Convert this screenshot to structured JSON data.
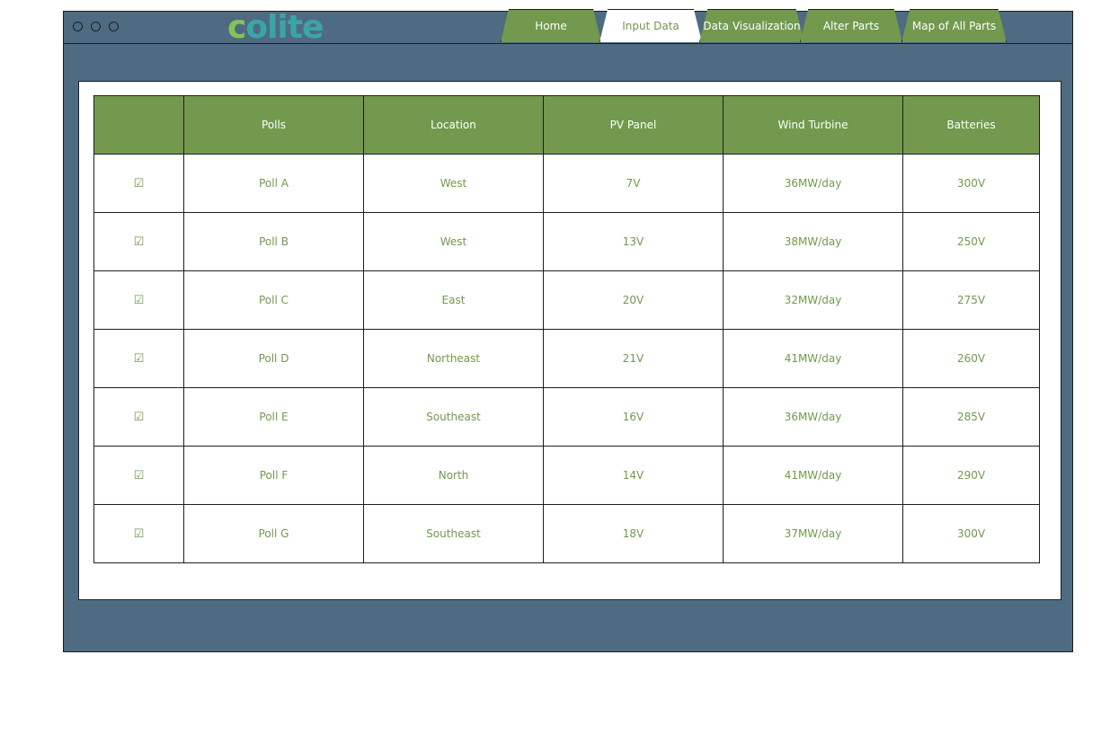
{
  "app": {
    "logo_first": "c",
    "logo_rest": "olite"
  },
  "tabs": [
    {
      "label": "Home",
      "active": false
    },
    {
      "label": "Input Data",
      "active": true
    },
    {
      "label": "Data Visualization",
      "active": false
    },
    {
      "label": "Alter Parts",
      "active": false
    },
    {
      "label": "Map of All Parts",
      "active": false
    }
  ],
  "table": {
    "headers": [
      "",
      "Polls",
      "Location",
      "PV Panel",
      "Wind Turbine",
      "Batteries"
    ],
    "check_glyph": "☑",
    "rows": [
      {
        "poll": "Poll A",
        "location": "West",
        "pv": "7V",
        "wind": "36MW/day",
        "batteries": "300V"
      },
      {
        "poll": "Poll B",
        "location": "West",
        "pv": "13V",
        "wind": "38MW/day",
        "batteries": "250V"
      },
      {
        "poll": "Poll C",
        "location": "East",
        "pv": "20V",
        "wind": "32MW/day",
        "batteries": "275V"
      },
      {
        "poll": "Poll D",
        "location": "Northeast",
        "pv": "21V",
        "wind": "41MW/day",
        "batteries": "260V"
      },
      {
        "poll": "Poll E",
        "location": "Southeast",
        "pv": "16V",
        "wind": "36MW/day",
        "batteries": "285V"
      },
      {
        "poll": "Poll F",
        "location": "North",
        "pv": "14V",
        "wind": "41MW/day",
        "batteries": "290V"
      },
      {
        "poll": "Poll G",
        "location": "Southeast",
        "pv": "18V",
        "wind": "37MW/day",
        "batteries": "300V"
      }
    ]
  },
  "colors": {
    "frame": "#4f6b82",
    "accent": "#72994e",
    "logo_c": "#84c35a",
    "logo_rest": "#3aa6a2"
  }
}
